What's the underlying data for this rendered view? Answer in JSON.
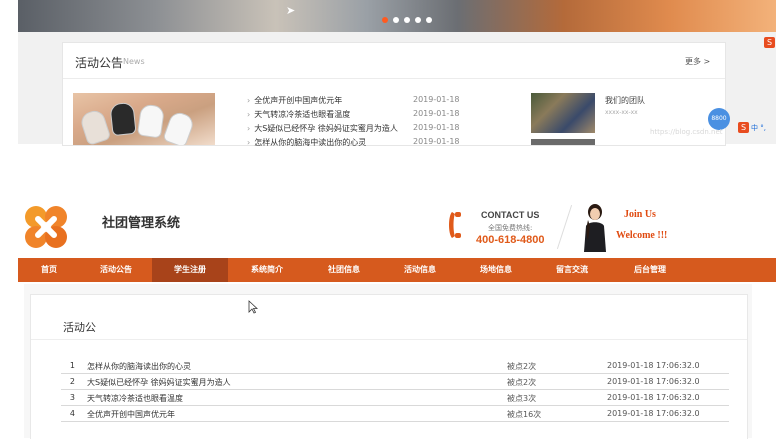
{
  "top": {
    "news_title": "活动公告",
    "news_subtitle": "News",
    "news_more": "更多 >",
    "news_items": [
      "全优声开创中国声优元年",
      "天气转凉冷茶适也眼看温度",
      "大S疑似已经怀孕 徐妈妈证实蜜月为造人",
      "怎样从你的脑海中读出你的心灵"
    ],
    "news_dates": [
      "2019-01-18",
      "2019-01-18",
      "2019-01-18",
      "2019-01-18"
    ],
    "team_title": "我们的团队",
    "team_sub": "xxxx-xx-xx",
    "float_badge": "8800",
    "ime_label": "中 °, ",
    "ime_s": "S",
    "watermark": "https://blog.csdn.net"
  },
  "header": {
    "site_name": "社团管理系统",
    "contact_title": "CONTACT US",
    "contact_sub": "全国免费热线:",
    "contact_phone": "400-618-4800",
    "join_line1": "Join Us",
    "join_line2": "Welcome !!!"
  },
  "nav": {
    "items": [
      "首页",
      "活动公告",
      "学生注册",
      "系统简介",
      "社团信息",
      "活动信息",
      "场地信息",
      "留言交流",
      "后台管理"
    ],
    "active_index": 2
  },
  "panel": {
    "title": "活动公",
    "rows": [
      {
        "num": "1",
        "title": "怎样从你的脑海读出你的心灵",
        "clicks": "被点2次",
        "time": "2019-01-18 17:06:32.0"
      },
      {
        "num": "2",
        "title": "大S疑似已经怀孕 徐妈妈证实蜜月为造人",
        "clicks": "被点2次",
        "time": "2019-01-18 17:06:32.0"
      },
      {
        "num": "3",
        "title": "天气转凉冷茶适也眼看温度",
        "clicks": "被点3次",
        "time": "2019-01-18 17:06:32.0"
      },
      {
        "num": "4",
        "title": "全优声开创中国声优元年",
        "clicks": "被点16次",
        "time": "2019-01-18 17:06:32.0"
      }
    ]
  },
  "colors": {
    "brand_orange": "#d65a1e",
    "nav_active": "#a8431a",
    "accent_red": "#e04a10"
  }
}
